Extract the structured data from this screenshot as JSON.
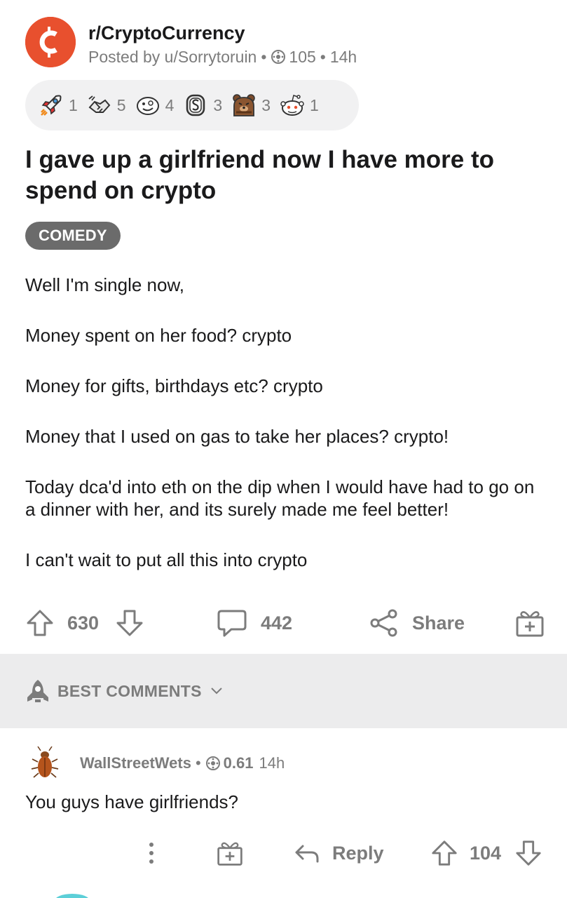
{
  "post": {
    "subreddit": "r/CryptoCurrency",
    "posted_by": "Posted by u/Sorrytoruin",
    "author_karma": "105",
    "age": "14h",
    "title": "I gave up a girlfriend now I have more to spend on crypto",
    "flair": "COMEDY",
    "body": [
      "Well I'm single now,",
      "Money spent on her food? crypto",
      "Money for gifts, birthdays etc? crypto",
      "Money that I used on gas to take her places? crypto!",
      "Today dca'd into eth on the dip when I would have had to go on a dinner with her, and its surely made me feel better!",
      "I can't wait to put all this into crypto"
    ]
  },
  "awards": [
    {
      "icon": "rocket-award-icon",
      "count": "1"
    },
    {
      "icon": "handshake-award-icon",
      "count": "5"
    },
    {
      "icon": "face-award-icon",
      "count": "4"
    },
    {
      "icon": "coin-award-icon",
      "count": "3"
    },
    {
      "icon": "bear-award-icon",
      "count": "3"
    },
    {
      "icon": "snoo-award-icon",
      "count": "1"
    }
  ],
  "actions": {
    "score": "630",
    "comments": "442",
    "share_label": "Share"
  },
  "sort": {
    "label": "BEST COMMENTS"
  },
  "comment": {
    "user": "WallStreetWets",
    "karma": "0.61",
    "age": "14h",
    "text": "You guys have girlfriends?",
    "reply_label": "Reply",
    "score": "104"
  },
  "colors": {
    "subreddit_icon": "#e8502e",
    "meta_gray": "#7c7c7c",
    "award_bg": "#f1f1f2",
    "flair_bg": "#6b6b6b",
    "sortbar_bg": "#ececed"
  }
}
